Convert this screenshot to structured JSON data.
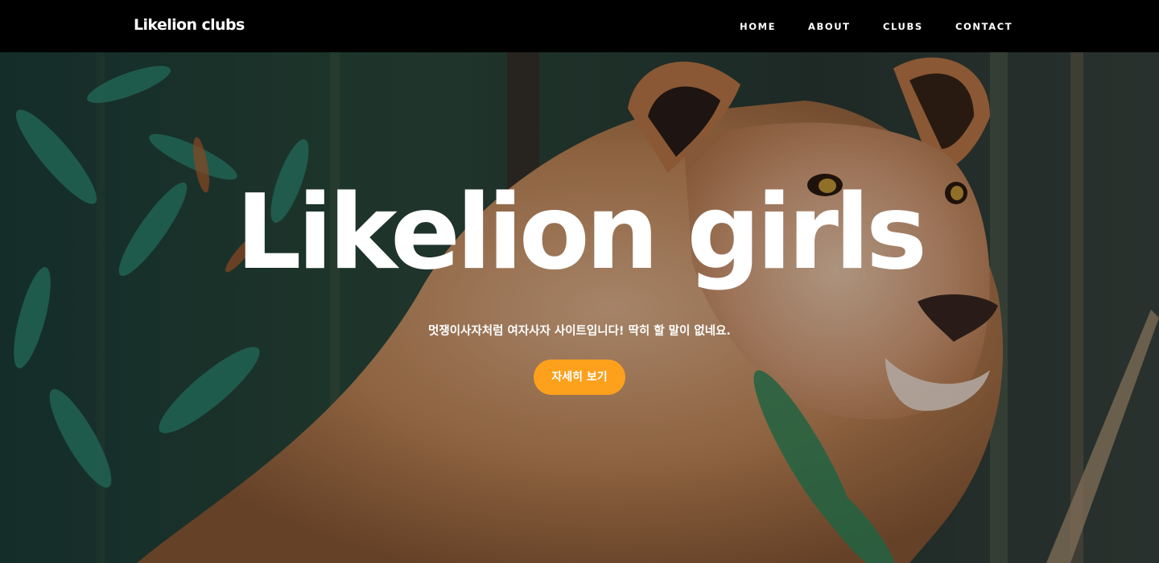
{
  "navbar": {
    "brand": "Likelion clubs",
    "links": [
      "HOME",
      "ABOUT",
      "CLUBS",
      "CONTACT"
    ]
  },
  "hero": {
    "title": "Likelion girls",
    "subtitle": "멋쟁이사자처럼 여자사자 사이트입니다! 딱히 할 말이 없네요.",
    "button_label": "자세히 보기",
    "background_image": "lioness-in-bamboo-forest",
    "accent_color": "#fda11d"
  }
}
